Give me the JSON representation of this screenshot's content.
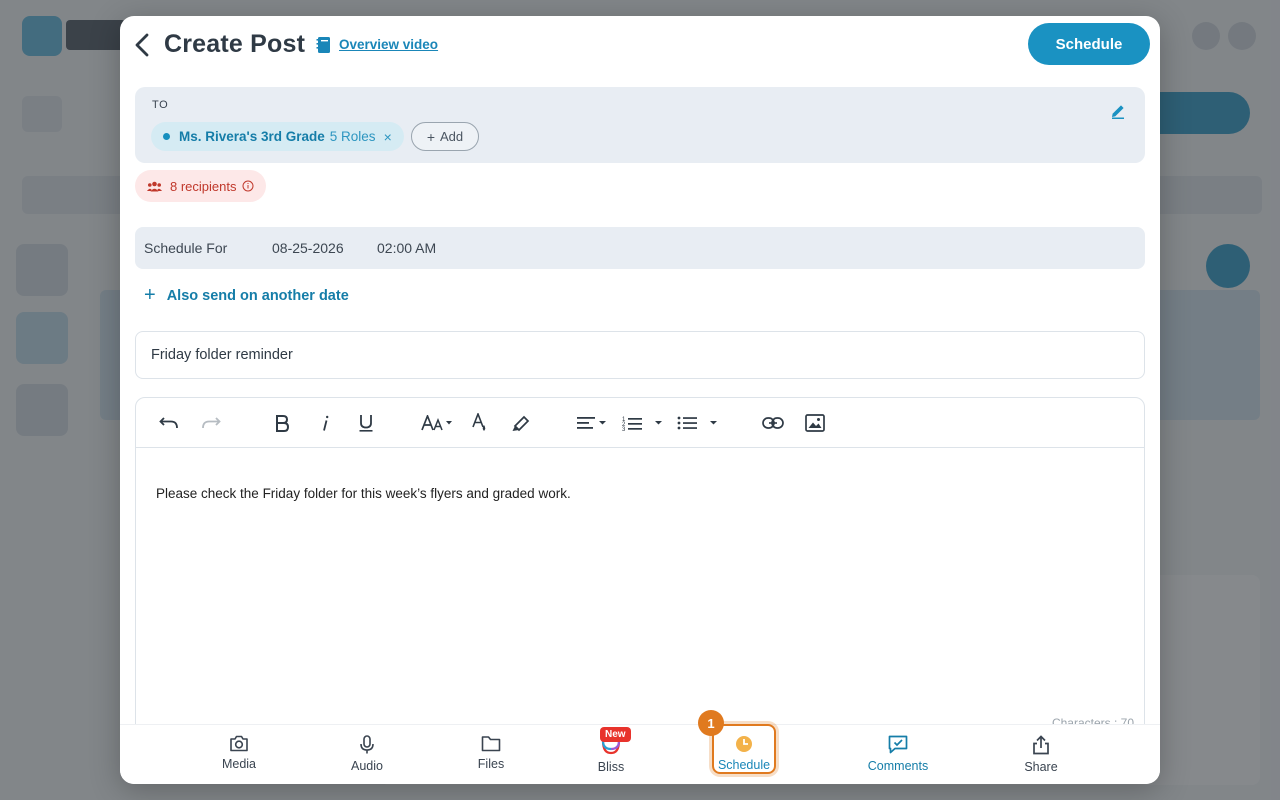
{
  "modal": {
    "title": "Create Post",
    "overview_link": "Overview video",
    "schedule_button": "Schedule"
  },
  "to": {
    "label": "TO",
    "chip_name": "Ms. Rivera's 3rd Grade",
    "chip_roles": "5 Roles",
    "chip_remove": "×",
    "add_label": "Add",
    "add_plus": "+"
  },
  "recipients": {
    "label": "8 recipients"
  },
  "schedule": {
    "label": "Schedule For",
    "date": "08-25-2026",
    "time": "02:00 AM",
    "also_send": "Also send on another date",
    "also_send_plus": "+"
  },
  "subject": {
    "value": "Friday folder reminder"
  },
  "editor": {
    "body": "Please check the Friday folder for this week’s flyers and graded work.",
    "char_count": "Characters : 70",
    "toolbar": [
      "undo-icon",
      "redo-icon",
      "bold-icon",
      "italic-icon",
      "underline-icon",
      "font-size-icon",
      "text-color-icon",
      "highlight-icon",
      "align-icon",
      "numbered-list-icon",
      "bullet-list-icon",
      "link-icon",
      "image-icon"
    ]
  },
  "bottom_bar": {
    "tabs": [
      {
        "label": "Media",
        "icon": "camera-icon"
      },
      {
        "label": "Audio",
        "icon": "mic-icon"
      },
      {
        "label": "Files",
        "icon": "folder-icon"
      },
      {
        "label": "Bliss",
        "icon": "bliss-icon",
        "badge": "New"
      },
      {
        "label": "Schedule",
        "icon": "clock-icon"
      },
      {
        "label": "Comments",
        "icon": "comment-icon"
      },
      {
        "label": "Share",
        "icon": "share-icon"
      }
    ],
    "step_badge": "1"
  },
  "colors": {
    "primary": "#1a92c2",
    "link": "#157da8",
    "danger": "#c0382b",
    "highlight": "#e07a1f"
  }
}
